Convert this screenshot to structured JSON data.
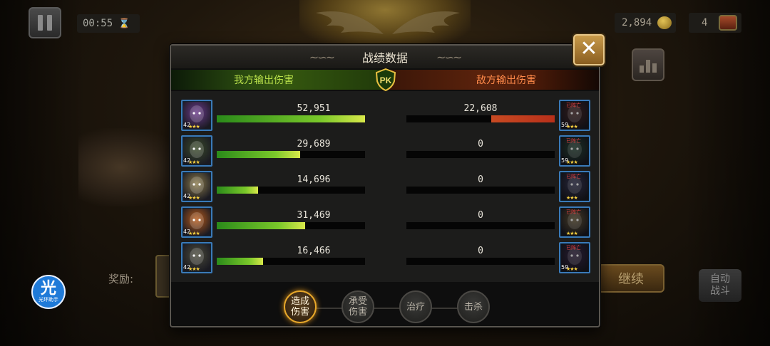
{
  "hud": {
    "timer": "00:55",
    "gold": "2,894",
    "chests": "4",
    "reward_label": "奖励:",
    "continue_label": "继续",
    "auto_label": "自动\n战斗",
    "assist_big": "光",
    "assist_small": "光环助手"
  },
  "modal": {
    "title": "战绩数据",
    "ally_header": "我方输出伤害",
    "enemy_header": "敌方输出伤害",
    "pk_label": "PK",
    "close_symbol": "✕",
    "dead_tag": "已阵亡"
  },
  "rows": [
    {
      "ally_damage": "52,951",
      "ally_fraction": 1.0,
      "ally_level": "42",
      "enemy_damage": "22,608",
      "enemy_fraction": 0.427,
      "enemy_level": "59",
      "enemy_dead": true
    },
    {
      "ally_damage": "29,689",
      "ally_fraction": 0.561,
      "ally_level": "42",
      "enemy_damage": "0",
      "enemy_fraction": 0,
      "enemy_level": "59",
      "enemy_dead": true
    },
    {
      "ally_damage": "14,696",
      "ally_fraction": 0.278,
      "ally_level": "42",
      "enemy_damage": "0",
      "enemy_fraction": 0,
      "enemy_level": "",
      "enemy_dead": true
    },
    {
      "ally_damage": "31,469",
      "ally_fraction": 0.594,
      "ally_level": "42",
      "enemy_damage": "0",
      "enemy_fraction": 0,
      "enemy_level": "",
      "enemy_dead": true
    },
    {
      "ally_damage": "16,466",
      "ally_fraction": 0.311,
      "ally_level": "42",
      "enemy_damage": "0",
      "enemy_fraction": 0,
      "enemy_level": "59",
      "enemy_dead": true
    }
  ],
  "tabs": [
    {
      "label": "造成\n伤害",
      "active": true
    },
    {
      "label": "承受\n伤害",
      "active": false
    },
    {
      "label": "治疗",
      "active": false
    },
    {
      "label": "击杀",
      "active": false
    }
  ],
  "colors": {
    "ally_accent": "#b8e04a",
    "enemy_accent": "#ff8a4a",
    "tab_active": "#e8a82a",
    "portrait_border": "#3a7ab8"
  },
  "portrait_palette": {
    "ally": [
      "#6a3a8a",
      "#3a4a2a",
      "#8a7a4a",
      "#b85a1a",
      "#4a4a3a"
    ],
    "enemy": [
      "#4a2a2a",
      "#2a4a3a",
      "#3a3a5a",
      "#6a5a3a",
      "#3a2a4a"
    ]
  }
}
